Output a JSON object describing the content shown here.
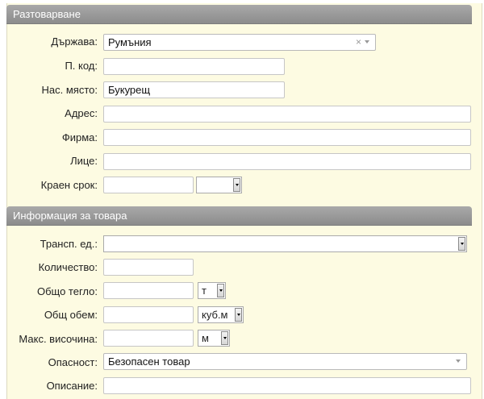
{
  "sections": {
    "unloading": "Разтоварване",
    "goods": "Информация за товара"
  },
  "unloading": {
    "country_label": "Държава:",
    "country_value": "Румъния",
    "country_clear": "×",
    "postcode_label": "П. код:",
    "postcode_value": "",
    "city_label": "Нас. място:",
    "city_value": "Букурещ",
    "address_label": "Адрес:",
    "address_value": "",
    "company_label": "Фирма:",
    "company_value": "",
    "person_label": "Лице:",
    "person_value": "",
    "deadline_label": "Краен срок:",
    "deadline_value": "",
    "deadline_select_value": ""
  },
  "goods": {
    "transport_unit_label": "Трансп. ед.:",
    "transport_unit_value": "",
    "quantity_label": "Количество:",
    "quantity_value": "",
    "total_weight_label": "Общо тегло:",
    "total_weight_value": "",
    "weight_unit": "т",
    "total_volume_label": "Общ обем:",
    "total_volume_value": "",
    "volume_unit": "куб.м",
    "max_height_label": "Макс. височина:",
    "max_height_value": "",
    "height_unit": "м",
    "danger_label": "Опасност:",
    "danger_value": "Безопасен товар",
    "description_label": "Описание:",
    "description_value": ""
  }
}
